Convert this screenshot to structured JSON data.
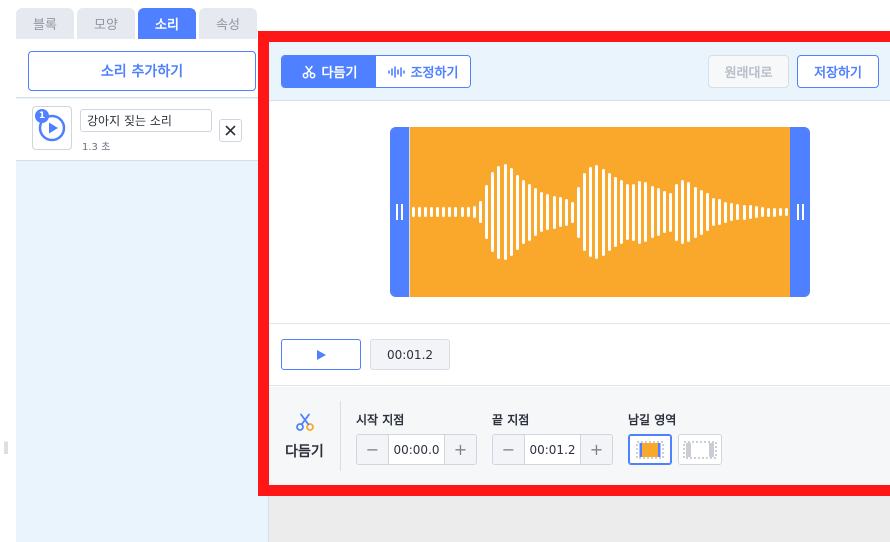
{
  "tabs": [
    {
      "label": "블록",
      "active": false
    },
    {
      "label": "모양",
      "active": false
    },
    {
      "label": "소리",
      "active": true
    },
    {
      "label": "속성",
      "active": false
    }
  ],
  "sound_panel": {
    "add_button_label": "소리 추가하기",
    "items": [
      {
        "number": "1",
        "name": "강아지 짖는 소리",
        "duration": "1.3 초"
      }
    ]
  },
  "editor": {
    "modes": [
      {
        "label": "다듬기",
        "icon": "scissors-icon",
        "active": true
      },
      {
        "label": "조정하기",
        "icon": "waveform-icon",
        "active": false
      }
    ],
    "reset_label": "원래대로",
    "reset_enabled": false,
    "save_label": "저장하기",
    "waveform": {
      "amplitudes": [
        0.07,
        0.07,
        0.07,
        0.07,
        0.07,
        0.07,
        0.07,
        0.07,
        0.07,
        0.07,
        0.08,
        0.15,
        0.36,
        0.53,
        0.62,
        0.64,
        0.59,
        0.5,
        0.43,
        0.38,
        0.32,
        0.27,
        0.24,
        0.22,
        0.2,
        0.18,
        0.14,
        0.34,
        0.52,
        0.6,
        0.63,
        0.58,
        0.52,
        0.47,
        0.43,
        0.37,
        0.38,
        0.42,
        0.4,
        0.35,
        0.32,
        0.28,
        0.26,
        0.38,
        0.43,
        0.4,
        0.34,
        0.3,
        0.25,
        0.19,
        0.17,
        0.14,
        0.12,
        0.11,
        0.1,
        0.09,
        0.08,
        0.07,
        0.06,
        0.06,
        0.05,
        0.05
      ],
      "colors": {
        "background": "#f9a82c",
        "handle": "#4f80ff",
        "bar": "#ffffff"
      }
    },
    "play_icon": "play-icon",
    "current_time": "00:01.2",
    "trim": {
      "title": "다듬기",
      "start_label": "시작 지점",
      "start_value": "00:00.0",
      "end_label": "끝 지점",
      "end_value": "00:01.2",
      "region_label": "남길 영역",
      "region_options": [
        {
          "name": "keep-selected-region",
          "selected": true
        },
        {
          "name": "remove-selected-region",
          "selected": false
        }
      ]
    }
  },
  "colors": {
    "accent": "#4f80ff",
    "highlight_frame": "#ff1616",
    "panel_bg": "#e9f4fc"
  }
}
